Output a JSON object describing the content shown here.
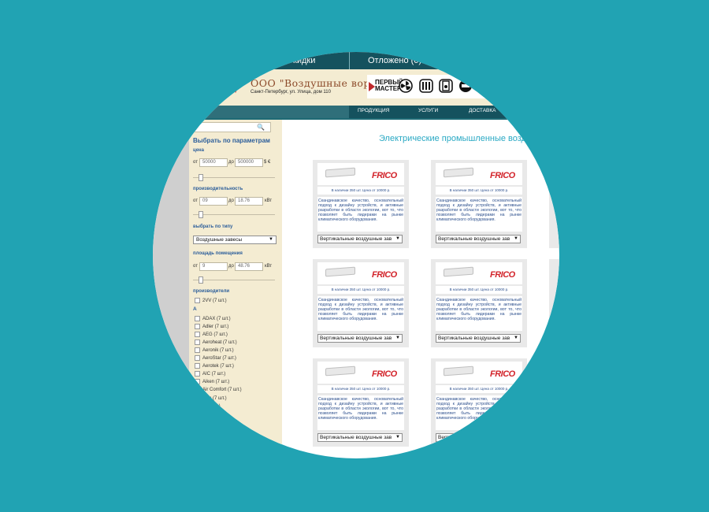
{
  "topbar": {
    "discounts_label": "кидки",
    "deferred_label": "Отложено (0)"
  },
  "header": {
    "company_name": "ООО \"Воздушные ворота\"",
    "address": "Санкт-Петербург, ул. Улица, дом 110",
    "partner_label": "ПЕРВЫЙ МАСТЕР"
  },
  "nav": {
    "items": [
      "ПРОДУКЦИЯ",
      "УСЛУГИ",
      "ДОСТАВКА"
    ]
  },
  "sidebar": {
    "title": "Выбрать по параметрам",
    "price": {
      "label": "цена",
      "from_label": "от",
      "from_value": "50000",
      "to_label": "до",
      "to_value": "500000",
      "currency": "$ €"
    },
    "power": {
      "label": "производительность",
      "from_label": "от",
      "from_value": "09",
      "to_label": "до",
      "to_value": "18.76",
      "unit": "кВт"
    },
    "type": {
      "label": "выбрать по типу",
      "selected": "Воздушные завесы"
    },
    "area": {
      "label": "площадь помещения",
      "from_label": "от",
      "from_value": "9",
      "to_label": "до",
      "to_value": "48.76",
      "unit": "кВт"
    },
    "manufacturers": {
      "label": "производители",
      "top_item": "2VV (7 шт.)",
      "letter": "A",
      "items": [
        "ADAX (7 шт.)",
        "Adler (7 шт.)",
        "AEG (7 шт.)",
        "Aeroheat (7 шт.)",
        "Aeronik (7 шт.)",
        "AeroStar (7 шт.)",
        "Aerotek (7 шт.)",
        "AIC (7 шт.)",
        "Aiken (7 шт.)",
        "Air Comfort (7 шт.)",
        "...ас (7 шт.)",
        "...(7 шт.)"
      ]
    }
  },
  "content": {
    "title": "Электрические промышленные возд",
    "card": {
      "brand": "FRICO",
      "stock": "В наличии 350 шт. Цена от 10000 р.",
      "description": "Скандинавское качество, основательный подход к дизайну устройств, и активные разработки в области экологии, вот то, что позволяет быть лидерами на рынке климатического оборудования.",
      "category": "Вертикальные воздушные зав"
    }
  },
  "colors": {
    "background": "#21a3b3",
    "topbar": "#15525e",
    "header": "#f4ecd2",
    "accent": "#2aa9c4",
    "brand_red": "#d2232a"
  }
}
